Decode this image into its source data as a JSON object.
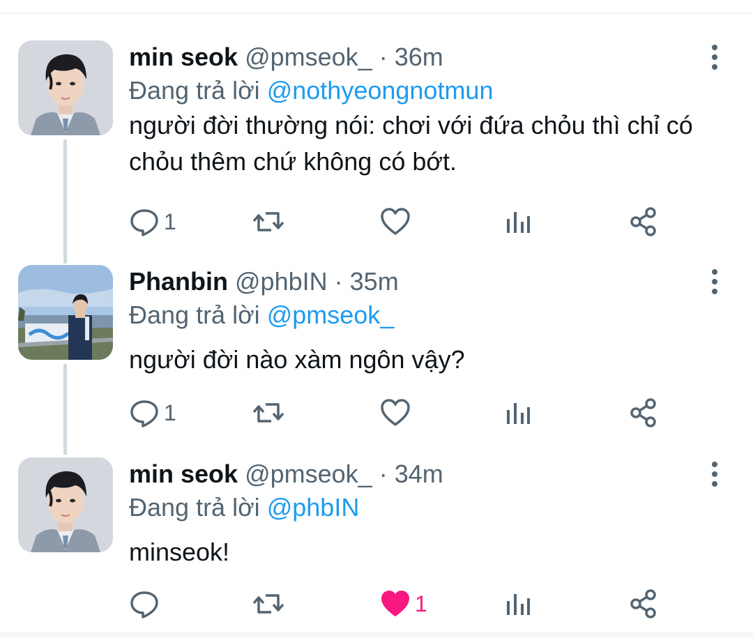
{
  "tweets": [
    {
      "name": "min seok",
      "handle": "@pmseok_",
      "dot": "·",
      "time": "36m",
      "replying_prefix": "Đang trả lời",
      "replying_to": "@nothyeongnotmun",
      "text": "người đời thường nói: chơi với đứa chỏu thì chỉ có chỏu thêm chứ không có bớt.",
      "avatar_icon": "person-photo-avatar",
      "reply_count": "1",
      "like_count": "",
      "liked": false
    },
    {
      "name": "Phanbin",
      "handle": "@phbIN",
      "dot": "·",
      "time": "35m",
      "replying_prefix": "Đang trả lời",
      "replying_to": "@pmseok_",
      "text": "người đời nào xàm ngôn vậy?",
      "avatar_icon": "riverside-photo-avatar",
      "reply_count": "1",
      "like_count": "",
      "liked": false
    },
    {
      "name": "min seok",
      "handle": "@pmseok_",
      "dot": "·",
      "time": "34m",
      "replying_prefix": "Đang trả lời",
      "replying_to": "@phbIN",
      "text": "minseok!",
      "avatar_icon": "person-photo-avatar",
      "reply_count": "",
      "like_count": "1",
      "liked": true
    }
  ],
  "icons": {
    "reply": "speech-bubble-icon",
    "retweet": "retweet-arrows-icon",
    "like": "heart-icon",
    "analytics": "bar-chart-icon",
    "share": "share-nodes-icon",
    "more": "vertical-dots-icon"
  },
  "colors": {
    "accent": "#1d9bf0",
    "like": "#f91880",
    "muted": "#536471",
    "text": "#0f1419",
    "thread_line": "#cfd9de"
  }
}
